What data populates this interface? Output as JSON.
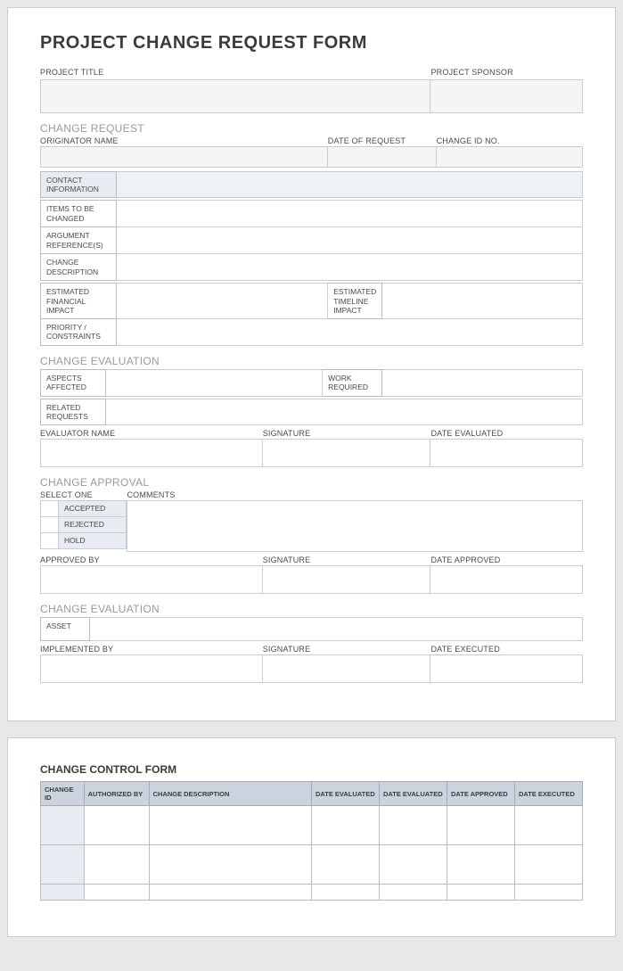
{
  "title": "PROJECT CHANGE REQUEST FORM",
  "head": {
    "project_title": "PROJECT TITLE",
    "project_sponsor": "PROJECT SPONSOR"
  },
  "sections": {
    "change_request": "CHANGE REQUEST",
    "change_evaluation": "CHANGE EVALUATION",
    "change_approval": "CHANGE APPROVAL",
    "change_evaluation2": "CHANGE EVALUATION"
  },
  "cr": {
    "originator_name": "ORIGINATOR NAME",
    "date_of_request": "DATE OF REQUEST",
    "change_id_no": "CHANGE ID NO.",
    "contact_information": "CONTACT INFORMATION",
    "items_to_be_changed": "ITEMS TO BE CHANGED",
    "argument_references": "ARGUMENT REFERENCE(S)",
    "change_description": "CHANGE DESCRIPTION",
    "estimated_financial_impact": "ESTIMATED FINANCIAL IMPACT",
    "estimated_timeline_impact": "ESTIMATED TIMELINE IMPACT",
    "priority_constraints": "PRIORITY / CONSTRAINTS"
  },
  "ce": {
    "aspects_affected": "ASPECTS AFFECTED",
    "work_required": "WORK REQUIRED",
    "related_requests": "RELATED REQUESTS",
    "evaluator_name": "EVALUATOR NAME",
    "signature": "SIGNATURE",
    "date_evaluated": "DATE EVALUATED"
  },
  "ca": {
    "select_one": "SELECT ONE",
    "comments": "COMMENTS",
    "accepted": "ACCEPTED",
    "rejected": "REJECTED",
    "hold": "HOLD",
    "approved_by": "APPROVED BY",
    "signature": "SIGNATURE",
    "date_approved": "DATE APPROVED"
  },
  "ce2": {
    "asset": "ASSET",
    "implemented_by": "IMPLEMENTED BY",
    "signature": "SIGNATURE",
    "date_executed": "DATE EXECUTED"
  },
  "ctrl": {
    "title": "CHANGE CONTROL FORM",
    "cols": {
      "change_id": "CHANGE ID",
      "authorized_by": "AUTHORIZED BY",
      "change_description": "CHANGE DESCRIPTION",
      "date_evaluated": "DATE EVALUATED",
      "date_evaluated2": "DATE EVALUATED",
      "date_approved": "DATE APPROVED",
      "date_executed": "DATE EXECUTED"
    }
  }
}
